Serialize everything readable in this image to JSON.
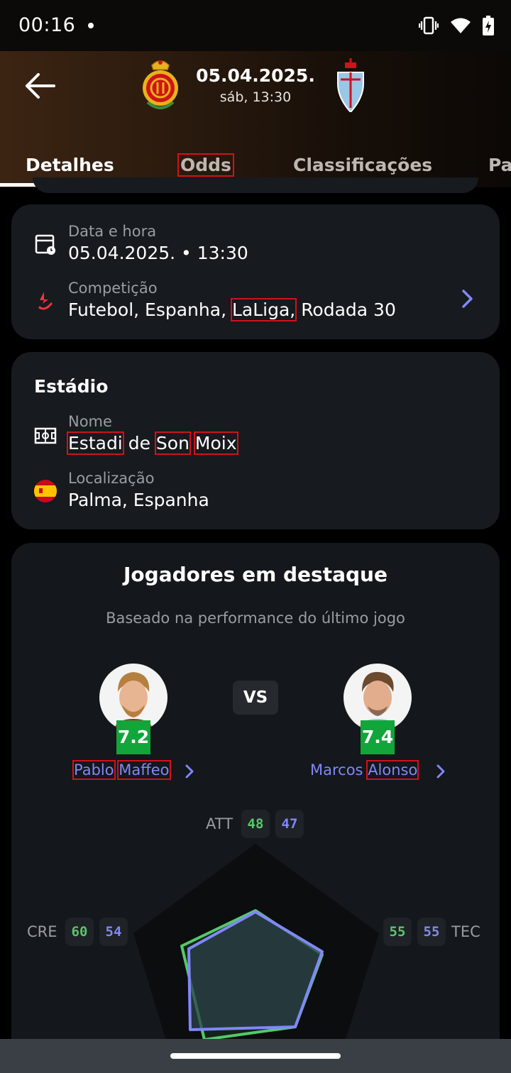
{
  "status": {
    "time": "00:16"
  },
  "header": {
    "date": "05.04.2025.",
    "time": "sáb, 13:30",
    "home_crest_icon": "rcd-mallorca-crest-icon",
    "away_crest_icon": "celta-vigo-crest-icon"
  },
  "tabs": [
    {
      "label": "Detalhes",
      "active": true
    },
    {
      "label": "Odds",
      "active": false
    },
    {
      "label": "Classificações",
      "active": false
    },
    {
      "label": "Pa",
      "active": false
    }
  ],
  "match_info": {
    "datetime_label": "Data e hora",
    "datetime_value": "05.04.2025. • 13:30",
    "competition_label": "Competição",
    "competition_prefix": "Futebol, Espanha,",
    "competition_league": "LaLiga,",
    "competition_round": "Rodada 30"
  },
  "stadium": {
    "title": "Estádio",
    "name_label": "Nome",
    "name_words": [
      "Estadi",
      "de",
      "Son",
      "Moix"
    ],
    "location_label": "Localização",
    "location_value": "Palma, Espanha"
  },
  "highlights": {
    "title": "Jogadores em destaque",
    "subtitle": "Baseado na performance do último jogo",
    "vs": "VS",
    "home_player": {
      "first": "Pablo",
      "last": "Maffeo",
      "rating": "7.2"
    },
    "away_player": {
      "first": "Marcos",
      "last": "Alonso",
      "rating": "7.4"
    },
    "stats": {
      "att": {
        "label": "ATT",
        "home": "48",
        "away": "47"
      },
      "cre": {
        "label": "CRE",
        "home": "60",
        "away": "54"
      },
      "tec": {
        "label": "TEC",
        "home": "55",
        "away": "55"
      }
    },
    "colors": {
      "home": "#55c96a",
      "away": "#8088f7",
      "rating": "#12a53a"
    }
  }
}
